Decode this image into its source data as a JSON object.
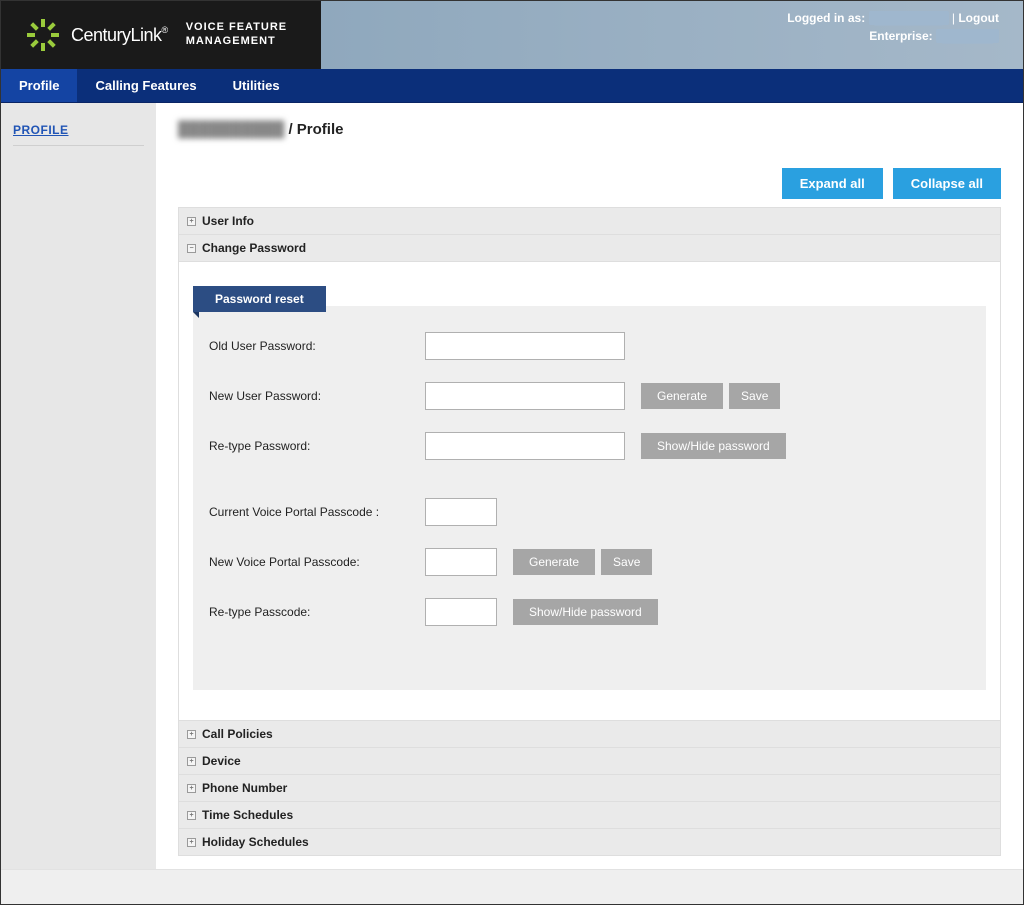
{
  "header": {
    "brand": "CenturyLink",
    "app_line1": "VOICE FEATURE",
    "app_line2": "MANAGEMENT",
    "logged_in_label": "Logged in as:",
    "logged_in_user": "████████",
    "logout": "Logout",
    "separator": " | ",
    "enterprise_label": "Enterprise:",
    "enterprise_value": "██████"
  },
  "nav": {
    "tabs": [
      {
        "label": "Profile",
        "active": true
      },
      {
        "label": "Calling Features",
        "active": false
      },
      {
        "label": "Utilities",
        "active": false
      }
    ]
  },
  "sidebar": {
    "link": "PROFILE"
  },
  "breadcrumb": {
    "masked": "██████████",
    "sep": " / ",
    "current": "Profile"
  },
  "actions": {
    "expand": "Expand all",
    "collapse": "Collapse all"
  },
  "accordion": {
    "user_info": "User Info",
    "change_password": "Change Password",
    "password_reset_title": "Password reset",
    "fields": {
      "old_user_password": "Old User Password:",
      "new_user_password": "New User Password:",
      "retype_password": "Re-type Password:",
      "current_voice_portal_passcode": "Current Voice Portal Passcode :",
      "new_voice_portal_passcode": "New Voice Portal Passcode:",
      "retype_passcode": "Re-type Passcode:"
    },
    "buttons": {
      "generate": "Generate",
      "save": "Save",
      "showhide": "Show/Hide password"
    },
    "call_policies": "Call Policies",
    "device": "Device",
    "phone_number": "Phone Number",
    "time_schedules": "Time Schedules",
    "holiday_schedules": "Holiday Schedules"
  },
  "colors": {
    "nav_bg": "#0b2f7a",
    "nav_active": "#1444a3",
    "btn_blue": "#2aa0e0",
    "panel_tab": "#2c4d83",
    "link": "#2054b5"
  }
}
